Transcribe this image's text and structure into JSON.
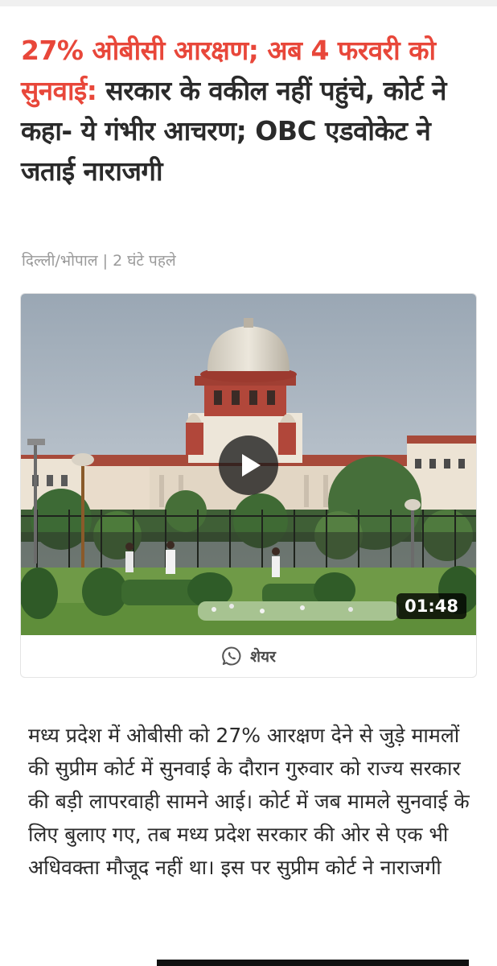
{
  "article": {
    "headline_highlight": "27% ओबीसी आरक्षण; अब 4 फरवरी को सुनवाई:",
    "headline_rest": " सरकार के वकील नहीं पहुंचे, कोर्ट ने कहा- ये गंभीर आचरण; OBC एडवोकेट ने जताई नाराजगी",
    "location": "दिल्ली/भोपाल",
    "separator": "|",
    "time": "2 घंटे पहले",
    "body": "मध्य प्रदेश में ओबीसी को 27% आरक्षण देने से जुड़े मामलों की सुप्रीम कोर्ट में सुनवाई के दौरान गुरुवार को राज्य सरकार की बड़ी लापरवाही सामने आई। कोर्ट में जब मामले सुनवाई के लिए बुलाए गए, तब मध्य प्रदेश सरकार की ओर से एक भी अधिवक्ता मौजूद नहीं था। इस पर सुप्रीम कोर्ट ने नाराजगी"
  },
  "video": {
    "duration": "01:48",
    "share_label": "शेयर",
    "play_icon": "play-icon",
    "share_icon": "whatsapp-icon"
  },
  "colors": {
    "headline_highlight": "#e8473a",
    "headline_text": "#2a2a2a",
    "meta_text": "#9a9a9a"
  }
}
